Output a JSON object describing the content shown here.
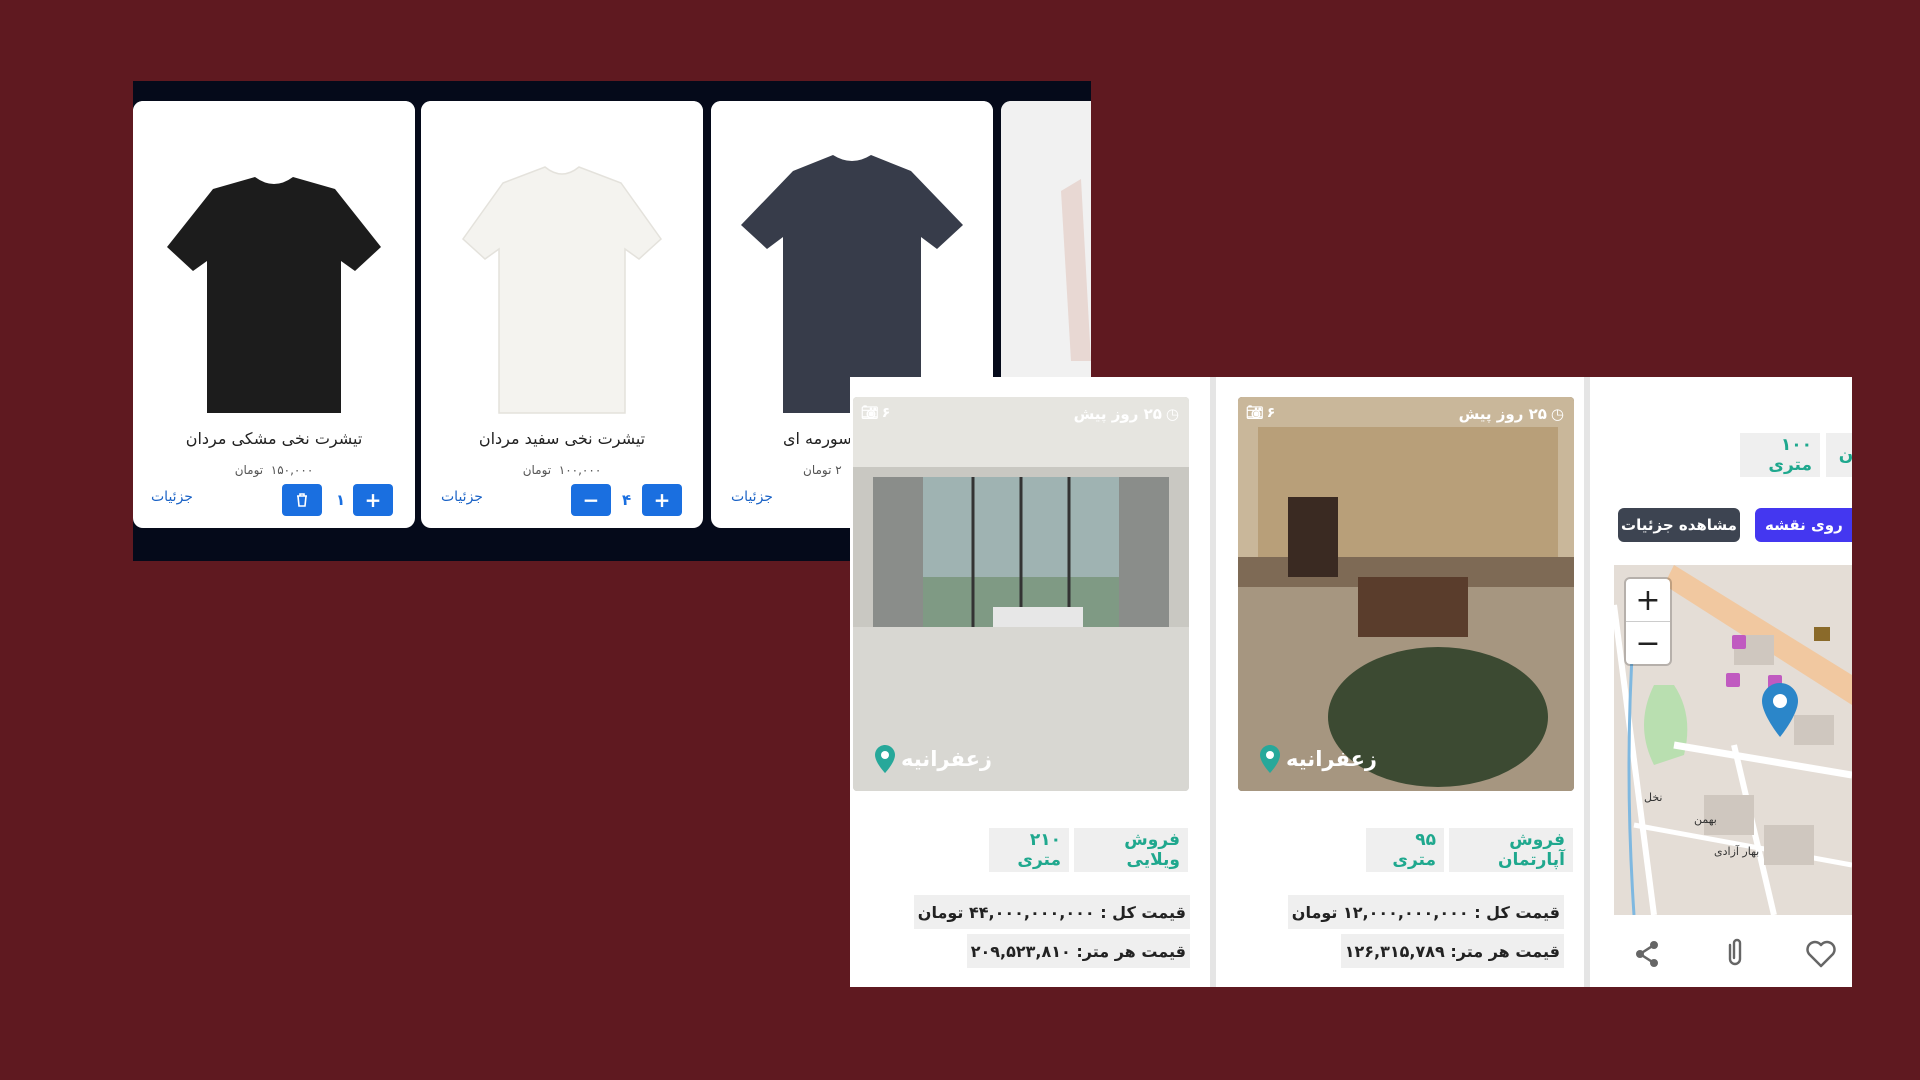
{
  "shop": {
    "products": [
      {
        "name": "تیشرت نخی مشکی مردان",
        "price": "۱۵۰,۰۰۰",
        "currency": "تومان",
        "qty": "۱",
        "details": "جزئیات",
        "color": "#1c1c1c"
      },
      {
        "name": "تیشرت نخی سفید مردان",
        "price": "۱۰۰,۰۰۰",
        "currency": "تومان",
        "qty": "۴",
        "details": "جزئیات",
        "color": "#f4f3ef"
      },
      {
        "name": "سورمه ای",
        "price": "۲",
        "currency": "تومان",
        "details": "جزئیات",
        "color": "#373c4a"
      }
    ]
  },
  "estate": {
    "listings": [
      {
        "time": "۲۵ روز پیش",
        "photos": "۶",
        "location": "زعفرانیه",
        "type": "فروش ویلایی",
        "area": "۲۱۰ متری",
        "total_label": "قیمت کل :",
        "total": "۴۴,۰۰۰,۰۰۰,۰۰۰ تومان",
        "per_meter_label": "قیمت هر متر:",
        "per_meter": "۲۰۹,۵۲۳,۸۱۰"
      },
      {
        "time": "۲۵ روز پیش",
        "photos": "۶",
        "location": "زعفرانیه",
        "type": "فروش آپارتمان",
        "area": "۹۵ متری",
        "total_label": "قیمت کل :",
        "total": "۱۲,۰۰۰,۰۰۰,۰۰۰ تومان",
        "per_meter_label": "قیمت هر متر:",
        "per_meter": "۱۲۶,۳۱۵,۷۸۹"
      }
    ],
    "detail": {
      "area": "۱۰۰ متری",
      "chip_partial": "ن",
      "view_details": "مشاهده جزئیات",
      "on_map": "روی نقشه",
      "zoom_in": "+",
      "zoom_out": "−",
      "map_labels": {
        "a": "بهار آزادی",
        "b": "نخل",
        "c": "بهمن"
      }
    }
  }
}
